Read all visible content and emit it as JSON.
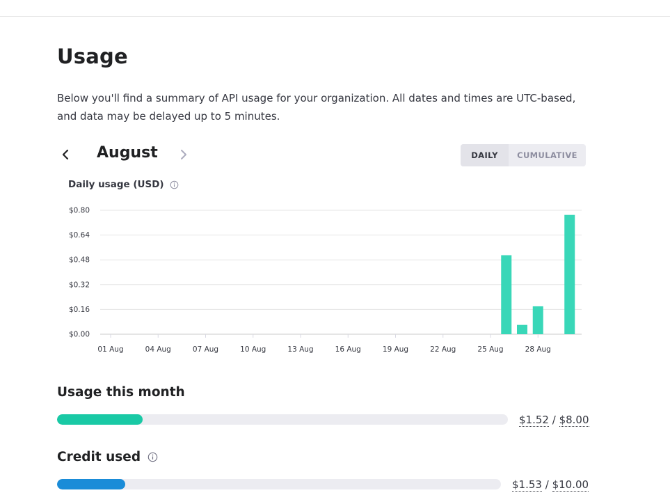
{
  "page": {
    "title": "Usage",
    "intro": "Below you'll find a summary of API usage for your organization. All dates and times are UTC-based, and data may be delayed up to 5 minutes."
  },
  "month_nav": {
    "month": "August",
    "prev_icon": "chevron-left-icon",
    "next_icon": "chevron-right-icon"
  },
  "toggle": {
    "daily": "DAILY",
    "cumulative": "CUMULATIVE",
    "selected": "DAILY"
  },
  "chart_heading": {
    "title": "Daily usage (USD)",
    "icon": "info-icon"
  },
  "chart_data": {
    "type": "bar",
    "title": "Daily usage (USD)",
    "xlabel": "",
    "ylabel": "",
    "ylim": [
      0,
      0.8
    ],
    "yticks": [
      {
        "value": 0.0,
        "label": "$0.00"
      },
      {
        "value": 0.16,
        "label": "$0.16"
      },
      {
        "value": 0.32,
        "label": "$0.32"
      },
      {
        "value": 0.48,
        "label": "$0.48"
      },
      {
        "value": 0.64,
        "label": "$0.64"
      },
      {
        "value": 0.8,
        "label": "$0.80"
      }
    ],
    "xtick_labels": [
      "01 Aug",
      "04 Aug",
      "07 Aug",
      "10 Aug",
      "13 Aug",
      "16 Aug",
      "19 Aug",
      "22 Aug",
      "25 Aug",
      "28 Aug"
    ],
    "categories": [
      "01 Aug",
      "02 Aug",
      "03 Aug",
      "04 Aug",
      "05 Aug",
      "06 Aug",
      "07 Aug",
      "08 Aug",
      "09 Aug",
      "10 Aug",
      "11 Aug",
      "12 Aug",
      "13 Aug",
      "14 Aug",
      "15 Aug",
      "16 Aug",
      "17 Aug",
      "18 Aug",
      "19 Aug",
      "20 Aug",
      "21 Aug",
      "22 Aug",
      "23 Aug",
      "24 Aug",
      "25 Aug",
      "26 Aug",
      "27 Aug",
      "28 Aug",
      "29 Aug",
      "30 Aug"
    ],
    "values": [
      0,
      0,
      0,
      0,
      0,
      0,
      0,
      0,
      0,
      0,
      0,
      0,
      0,
      0,
      0,
      0,
      0,
      0,
      0,
      0,
      0,
      0,
      0,
      0,
      0,
      0.51,
      0.06,
      0.18,
      0,
      0.77
    ],
    "grid": true,
    "color": "#39d7b8"
  },
  "usage_month": {
    "title": "Usage this month",
    "used": "$1.52",
    "limit": "$8.00",
    "separator": "/",
    "fraction": 0.19,
    "color": "#19c9a5"
  },
  "credit": {
    "title": "Credit used",
    "icon": "info-icon",
    "used": "$1.53",
    "limit": "$10.00",
    "separator": "/",
    "fraction": 0.153,
    "color": "#1a8cd8"
  }
}
